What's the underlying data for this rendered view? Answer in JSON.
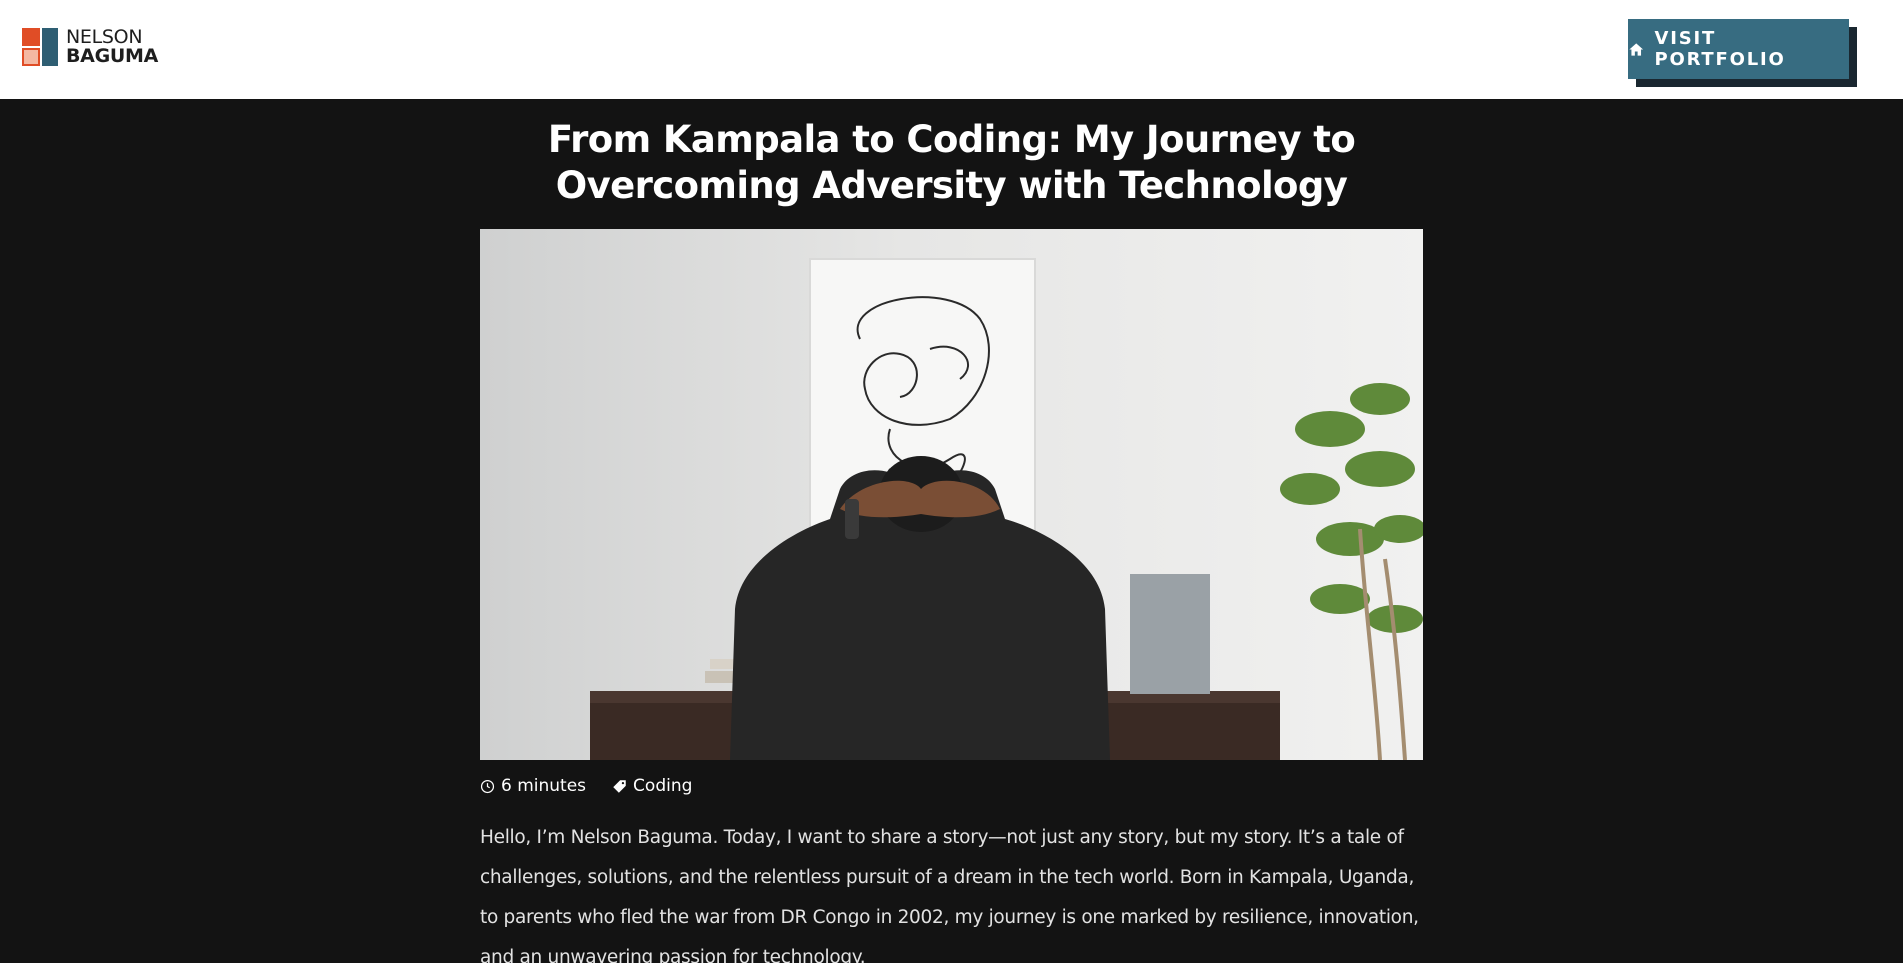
{
  "header": {
    "brand": {
      "line1": "NELSON",
      "line2": "BAGUMA"
    },
    "visit_button": {
      "label": "VISIT PORTFOLIO",
      "icon": "home-icon"
    }
  },
  "article": {
    "title": "From Kampala to Coding: My Journey to Overcoming Adversity with Technology",
    "hero_image": {
      "alt": "Person sitting at a desk with hands behind head"
    },
    "meta": {
      "read_time": "6 minutes",
      "read_time_icon": "clock-icon",
      "tag": "Coding",
      "tag_icon": "tag-icon"
    },
    "body": "Hello, I’m Nelson Baguma. Today, I want to share a story—not just any story, but my story. It’s a tale of challenges, solutions, and the relentless pursuit of a dream in the tech world. Born in Kampala, Uganda, to parents who fled the war from DR Congo in 2002, my journey is one marked by resilience, innovation, and an unwavering passion for technology."
  },
  "colors": {
    "page_background": "#131313",
    "header_background": "#ffffff",
    "button_background": "#376c81",
    "button_shadow": "#1a2730",
    "logo_orange": "#e04d26",
    "logo_blue": "#2e5e73"
  }
}
